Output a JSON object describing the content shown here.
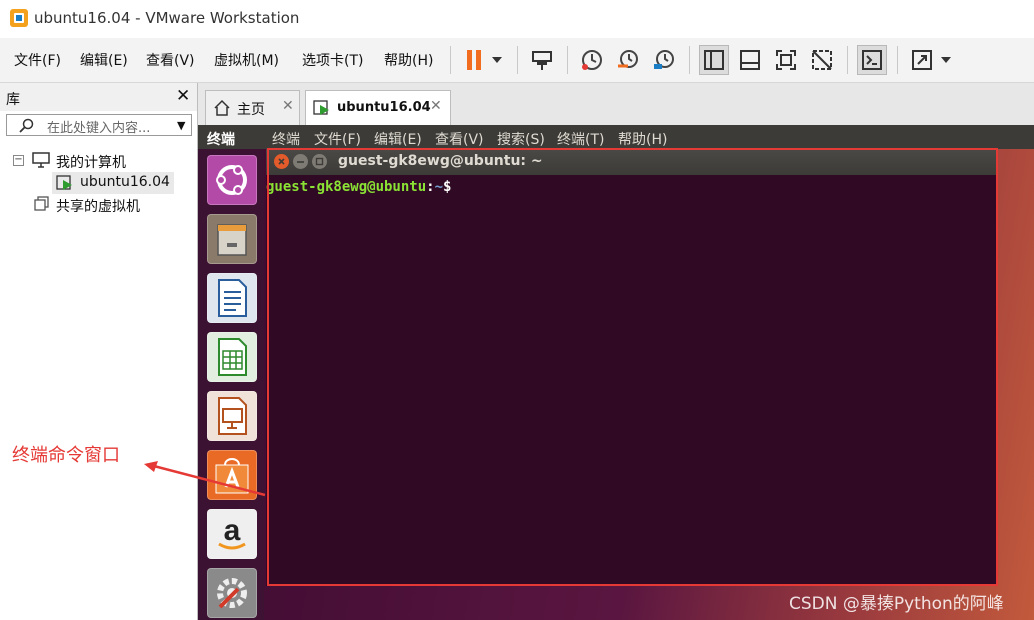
{
  "window": {
    "title": "ubuntu16.04 - VMware Workstation"
  },
  "menu": {
    "items": [
      "文件(F)",
      "编辑(E)",
      "查看(V)",
      "虚拟机(M)",
      "选项卡(T)",
      "帮助(H)"
    ]
  },
  "toolbar": {
    "icons": [
      "pause-icon",
      "dropdown-arrow-icon",
      "send-ctrl-alt-del-icon",
      "snapshot-icon",
      "revert-snapshot-icon",
      "snapshot-manager-icon",
      "library-view-icon",
      "thumbnail-view-icon",
      "fullscreen-icon",
      "unity-icon",
      "console-view-icon",
      "stretch-icon",
      "dropdown-arrow-icon"
    ]
  },
  "library": {
    "title": "库",
    "close": "✕",
    "search_placeholder": "在此处键入内容...",
    "tree": {
      "my_computer": "我的计算机",
      "vm": "ubuntu16.04",
      "shared": "共享的虚拟机"
    }
  },
  "tabs": [
    {
      "label": "主页",
      "active": false
    },
    {
      "label": "ubuntu16.04",
      "active": true
    }
  ],
  "ubuntu": {
    "app_name": "终端",
    "menus": [
      "终端",
      "文件(F)",
      "编辑(E)",
      "查看(V)",
      "搜索(S)",
      "终端(T)",
      "帮助(H)"
    ],
    "terminal_title": "guest-gk8ewg@ubuntu: ~",
    "prompt_user": "guest-gk8ewg@ubuntu",
    "prompt_sep": ":",
    "prompt_path": "~",
    "prompt_sym": "$"
  },
  "annotation": {
    "label": "终端命令窗口",
    "color": "#e53935"
  },
  "watermark": "CSDN @暴揍Python的阿峰",
  "colors": {
    "accent_red": "#e53935",
    "terminal_bg": "#300a24",
    "prompt_green": "#8ae234",
    "prompt_blue": "#729fcf"
  }
}
